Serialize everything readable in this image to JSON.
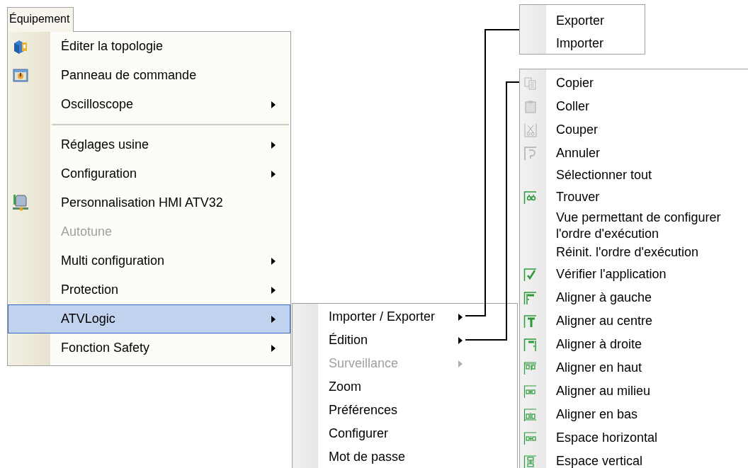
{
  "tab": {
    "label": "Équipement"
  },
  "main_menu": {
    "items": [
      {
        "kind": "item",
        "label": "Éditer la topologie",
        "submenu": false,
        "disabled": false,
        "selected": false
      },
      {
        "kind": "item",
        "label": "Panneau de commande",
        "submenu": false,
        "disabled": false,
        "selected": false
      },
      {
        "kind": "item",
        "label": "Oscilloscope",
        "submenu": true,
        "disabled": false,
        "selected": false
      },
      {
        "kind": "separator"
      },
      {
        "kind": "item",
        "label": "Réglages usine",
        "submenu": true,
        "disabled": false,
        "selected": false
      },
      {
        "kind": "item",
        "label": "Configuration",
        "submenu": true,
        "disabled": false,
        "selected": false
      },
      {
        "kind": "item",
        "label": "Personnalisation HMI ATV32",
        "submenu": false,
        "disabled": false,
        "selected": false
      },
      {
        "kind": "item",
        "label": "Autotune",
        "submenu": false,
        "disabled": true,
        "selected": false
      },
      {
        "kind": "item",
        "label": "Multi configuration",
        "submenu": true,
        "disabled": false,
        "selected": false
      },
      {
        "kind": "item",
        "label": "Protection",
        "submenu": true,
        "disabled": false,
        "selected": false
      },
      {
        "kind": "item",
        "label": "ATVLogic",
        "submenu": true,
        "disabled": false,
        "selected": true
      },
      {
        "kind": "item",
        "label": "Fonction Safety",
        "submenu": true,
        "disabled": false,
        "selected": false
      }
    ]
  },
  "atvlogic_menu": {
    "items": [
      {
        "kind": "item",
        "label": "Importer / Exporter",
        "submenu": true,
        "disabled": false
      },
      {
        "kind": "item",
        "label": "Édition",
        "submenu": true,
        "disabled": false
      },
      {
        "kind": "item",
        "label": "Surveillance",
        "submenu": true,
        "disabled": true
      },
      {
        "kind": "item",
        "label": "Zoom",
        "submenu": false,
        "disabled": false
      },
      {
        "kind": "item",
        "label": "Préférences",
        "submenu": false,
        "disabled": false
      },
      {
        "kind": "item",
        "label": "Configurer",
        "submenu": false,
        "disabled": false
      },
      {
        "kind": "item",
        "label": "Mot de passe",
        "submenu": false,
        "disabled": false
      }
    ]
  },
  "import_export_menu": {
    "items": [
      {
        "kind": "item",
        "label": "Exporter"
      },
      {
        "kind": "item",
        "label": "Importer"
      }
    ]
  },
  "edition_menu": {
    "items": [
      {
        "kind": "item",
        "label": "Copier"
      },
      {
        "kind": "item",
        "label": "Coller"
      },
      {
        "kind": "item",
        "label": "Couper"
      },
      {
        "kind": "item",
        "label": "Annuler"
      },
      {
        "kind": "item",
        "label": "Sélectionner tout"
      },
      {
        "kind": "item",
        "label": "Trouver"
      },
      {
        "kind": "item",
        "label": "Vue permettant de configurer l'ordre d'exécution"
      },
      {
        "kind": "item",
        "label": "Réinit. l'ordre d'exécution"
      },
      {
        "kind": "item",
        "label": "Vérifier l'application"
      },
      {
        "kind": "item",
        "label": "Aligner à gauche"
      },
      {
        "kind": "item",
        "label": "Aligner au centre"
      },
      {
        "kind": "item",
        "label": "Aligner à droite"
      },
      {
        "kind": "item",
        "label": "Aligner en haut"
      },
      {
        "kind": "item",
        "label": "Aligner au milieu"
      },
      {
        "kind": "item",
        "label": "Aligner en bas"
      },
      {
        "kind": "item",
        "label": "Espace horizontal"
      },
      {
        "kind": "item",
        "label": "Espace vertical"
      }
    ]
  }
}
